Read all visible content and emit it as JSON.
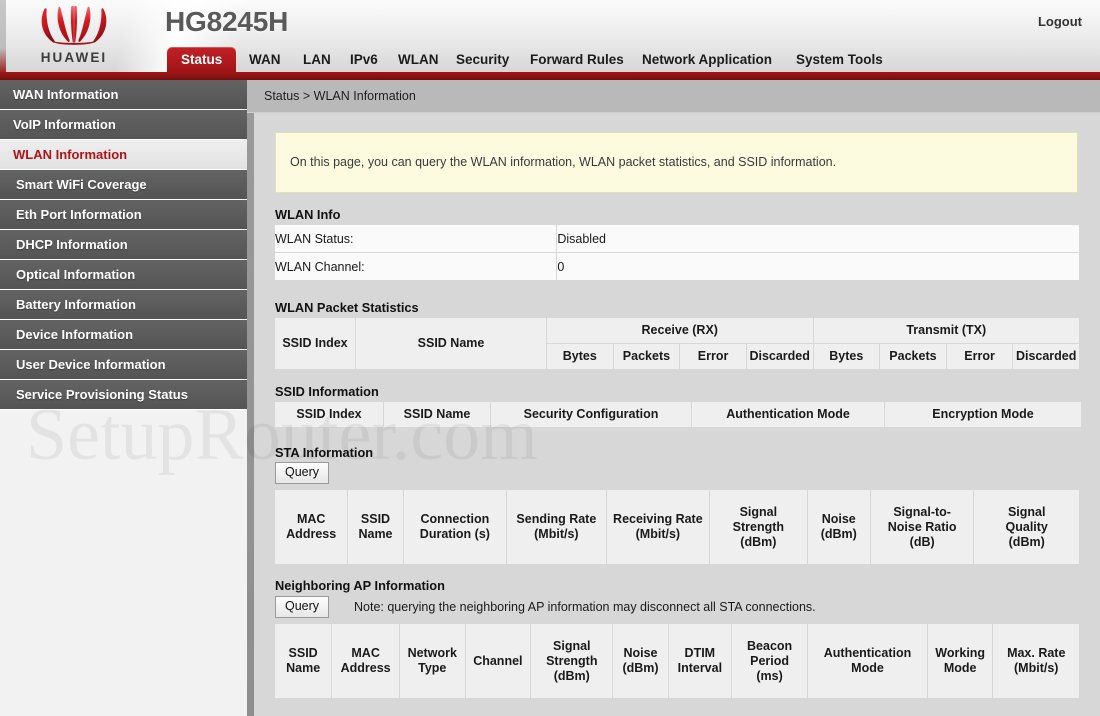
{
  "header": {
    "brand": "HUAWEI",
    "model": "HG8245H",
    "logout_label": "Logout"
  },
  "nav": {
    "items": [
      {
        "label": "Status",
        "active": true
      },
      {
        "label": "WAN",
        "active": false
      },
      {
        "label": "LAN",
        "active": false
      },
      {
        "label": "IPv6",
        "active": false
      },
      {
        "label": "WLAN",
        "active": false
      },
      {
        "label": "Security",
        "active": false
      },
      {
        "label": "Forward Rules",
        "active": false
      },
      {
        "label": "Network Application",
        "active": false
      },
      {
        "label": "System Tools",
        "active": false
      }
    ]
  },
  "sidebar": {
    "items": [
      {
        "label": "WAN Information",
        "selected": false
      },
      {
        "label": "VoIP Information",
        "selected": false
      },
      {
        "label": "WLAN Information",
        "selected": true
      },
      {
        "label": "Smart WiFi Coverage",
        "selected": false
      },
      {
        "label": "Eth Port Information",
        "selected": false
      },
      {
        "label": "DHCP Information",
        "selected": false
      },
      {
        "label": "Optical Information",
        "selected": false
      },
      {
        "label": "Battery Information",
        "selected": false
      },
      {
        "label": "Device Information",
        "selected": false
      },
      {
        "label": "User Device Information",
        "selected": false
      },
      {
        "label": "Service Provisioning Status",
        "selected": false
      }
    ]
  },
  "breadcrumb": "Status > WLAN Information",
  "notice": "On this page, you can query the WLAN information, WLAN packet statistics, and SSID information.",
  "wlan_info": {
    "title": "WLAN Info",
    "rows": [
      {
        "key": "WLAN Status:",
        "value": "Disabled"
      },
      {
        "key": "WLAN Channel:",
        "value": "0"
      }
    ]
  },
  "packet_stats": {
    "title": "WLAN Packet Statistics",
    "col_ssid_index": "SSID Index",
    "col_ssid_name": "SSID Name",
    "group_rx": "Receive (RX)",
    "group_tx": "Transmit (TX)",
    "rx_cols": [
      "Bytes",
      "Packets",
      "Error",
      "Discarded"
    ],
    "tx_cols": [
      "Bytes",
      "Packets",
      "Error",
      "Discarded"
    ],
    "rows": []
  },
  "ssid_info": {
    "title": "SSID Information",
    "columns": [
      "SSID Index",
      "SSID Name",
      "Security Configuration",
      "Authentication Mode",
      "Encryption Mode"
    ],
    "rows": []
  },
  "sta_info": {
    "title": "STA Information",
    "query_label": "Query",
    "columns": [
      "MAC\nAddress",
      "SSID\nName",
      "Connection\nDuration (s)",
      "Sending Rate\n(Mbit/s)",
      "Receiving Rate\n(Mbit/s)",
      "Signal\nStrength\n(dBm)",
      "Noise\n(dBm)",
      "Signal-to-\nNoise Ratio\n(dB)",
      "Signal\nQuality\n(dBm)"
    ],
    "rows": []
  },
  "neighbor_ap": {
    "title": "Neighboring AP Information",
    "query_label": "Query",
    "note": "Note: querying the neighboring AP information may disconnect all STA connections.",
    "columns": [
      "SSID\nName",
      "MAC\nAddress",
      "Network\nType",
      "Channel",
      "Signal\nStrength\n(dBm)",
      "Noise\n(dBm)",
      "DTIM\nInterval",
      "Beacon\nPeriod\n(ms)",
      "Authentication\nMode",
      "Working\nMode",
      "Max. Rate\n(Mbit/s)"
    ],
    "rows": []
  },
  "watermark": "SetupRouter.com",
  "colors": {
    "brand_red": "#b31b20",
    "header_rule": "#8e1212",
    "sidebar_item": "#5c5c5c",
    "sidebar_selected_text": "#b01317",
    "notice_bg": "#fcfbe0",
    "content_bg": "#d7d7d7"
  }
}
